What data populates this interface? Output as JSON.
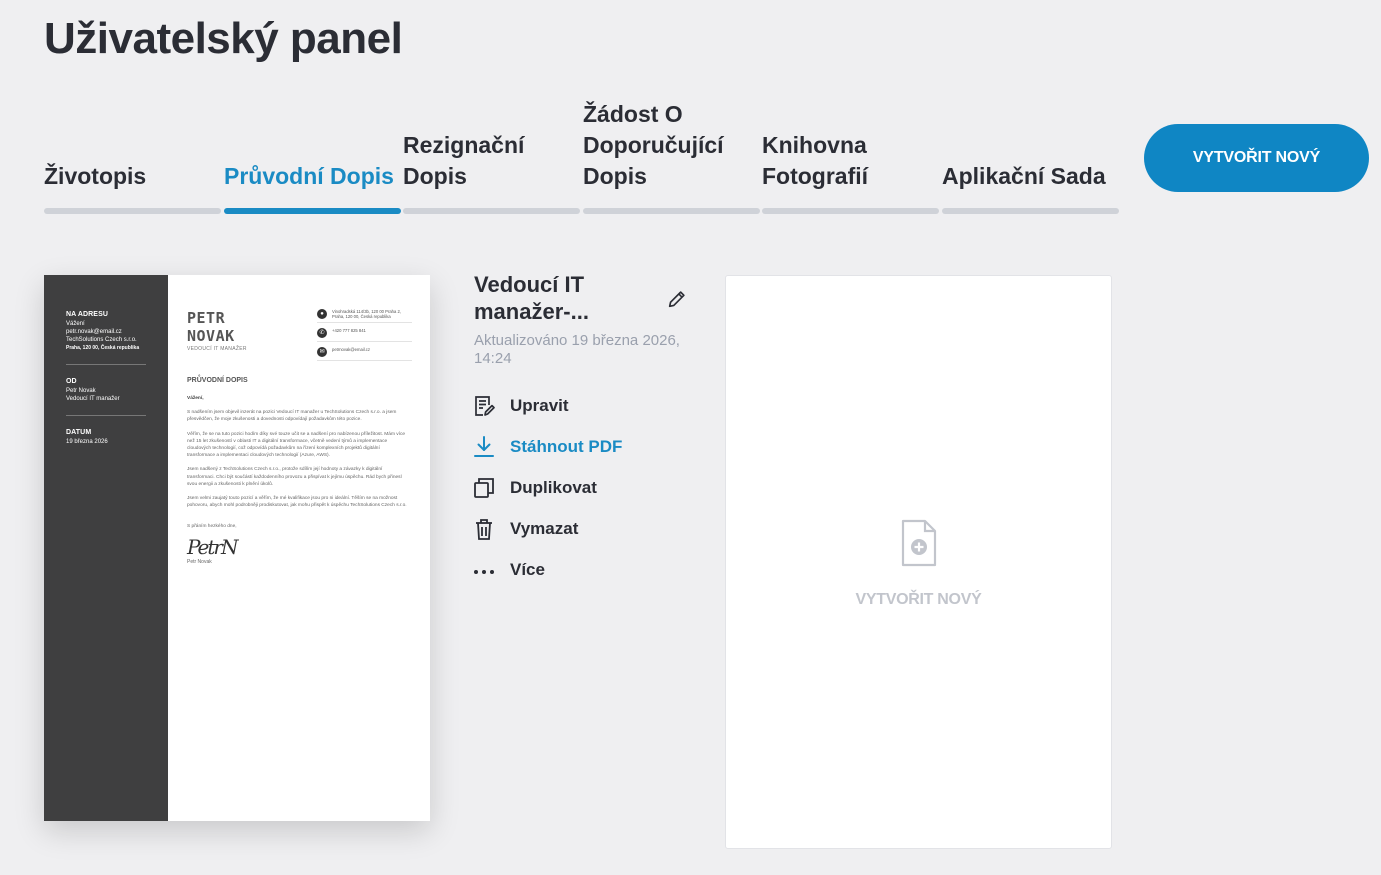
{
  "page_title": "Uživatelský panel",
  "tabs": [
    {
      "label": "Životopis",
      "active": false
    },
    {
      "label": "Průvodní Dopis",
      "active": true
    },
    {
      "label": "Rezignační Dopis",
      "active": false
    },
    {
      "label": "Žádost O Doporučující Dopis",
      "active": false
    },
    {
      "label": "Knihovna Fotografií",
      "active": false
    },
    {
      "label": "Aplikační Sada",
      "active": false
    }
  ],
  "new_button_label": "VYTVOŘIT NOVÝ",
  "colors": {
    "accent": "#0f86c4",
    "active_tab": "#1a8bc4",
    "background": "#efeff1"
  },
  "document_preview": {
    "sidebar": {
      "to_label": "NA ADRESU",
      "to_lines": [
        "Vážení",
        "petr.novak@email.cz",
        "TechSolutions Czech s.r.o."
      ],
      "to_address": "Praha, 120 00, Česká republika",
      "from_label": "OD",
      "from_lines": [
        "Petr Novak",
        "Vedoucí IT manažer"
      ],
      "date_label": "DATUM",
      "date_value": "19 března 2026"
    },
    "first_name": "PETR",
    "last_name": "NOVAK",
    "role": "VEDOUCÍ IT MANAŽER",
    "contact": {
      "address": "Vinohradská 114/3b, 120 00 Praha 2, Praha, 120 00, Česká republika",
      "phone": "+420 777 825 841",
      "email": "petrnovak@email.cz"
    },
    "section_title": "PRŮVODNÍ DOPIS",
    "greeting": "Vážení,",
    "paragraphs": [
      "S nadšením jsem objevil inzerát na pozici Vedoucí IT manažer u TechSolutions Czech s.r.o. a jsem přesvědčen, že moje zkušenosti a dovednosti odpovídají požadavkům této pozice.",
      "Věřím, že se na tuto pozici hodím díky své touze učit se a nadšení pro nabízenou příležitost. Mám více než 15 let zkušeností v oblasti IT a digitální transformace, včetně vedení týmů a implementace cloudových technologií, což odpovídá požadavkům na řízení komplexních projektů digitální transformace a implementaci cloudových technologií (Azure, AWS).",
      "Jsem nadšený z TechSolutions Czech s.r.o., protože sdílím její hodnoty a závazky k digitální transformaci. Chci být součástí každodenního provozu a přispívat k jejímu úspěchu. Rád bych přinesl svou energii a zkušenosti k plnění úkolů.",
      "Jsem velmi zaujatý touto pozicí a věřím, že mé kvalifikace jsou pro ni ideální. Těším se na možnost pohovoru, abych mohl podrobněji prodiskutovat, jak mohu přispět k úspěchu TechSolutions Czech s.r.o."
    ],
    "closing": "S přáním hezkého dne,",
    "signature": "PetrN",
    "signer": "Petr Novak"
  },
  "document_title": "Vedoucí IT manažer-...",
  "updated_text": "Aktualizováno 19 března 2026, 14:24",
  "actions": {
    "edit": "Upravit",
    "download": "Stáhnout PDF",
    "duplicate": "Duplikovat",
    "delete": "Vymazat",
    "more": "Více"
  },
  "create_card_label": "VYTVOŘIT NOVÝ",
  "icons": {
    "edit": "pencil-icon",
    "edit_action": "document-edit-icon",
    "download": "download-icon",
    "duplicate": "duplicate-icon",
    "delete": "trash-icon",
    "more": "more-dots-icon",
    "create": "add-file-icon"
  }
}
